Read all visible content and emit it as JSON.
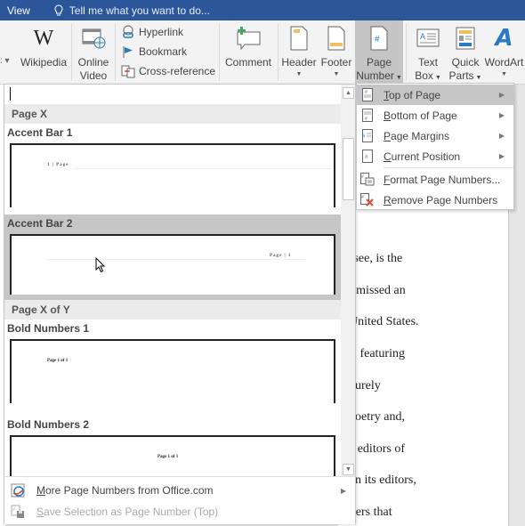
{
  "topbar": {
    "view_tab": "View",
    "tell_me_placeholder": "Tell me what you want to do...",
    "tell_me_icon": "lightbulb-icon"
  },
  "ribbon": {
    "buttons": [
      {
        "label": "Wikipedia",
        "icon": "wikipedia-icon"
      },
      {
        "label1": "Online",
        "label2": "Video",
        "icon": "online-video-icon"
      },
      {
        "label": "Comment",
        "icon": "comment-icon"
      },
      {
        "label": "Header",
        "icon": "header-icon"
      },
      {
        "label": "Footer",
        "icon": "footer-icon"
      },
      {
        "label1": "Page",
        "label2": "Number",
        "icon": "page-number-icon",
        "active": true
      },
      {
        "label1": "Text",
        "label2": "Box",
        "icon": "text-box-icon"
      },
      {
        "label1": "Quick",
        "label2": "Parts",
        "icon": "quick-parts-icon"
      },
      {
        "label": "WordArt",
        "icon": "wordart-icon"
      }
    ],
    "links": [
      {
        "label": "Hyperlink",
        "icon": "hyperlink-icon"
      },
      {
        "label": "Bookmark",
        "icon": "bookmark-icon"
      },
      {
        "label": "Cross-reference",
        "icon": "cross-reference-icon"
      }
    ]
  },
  "gallery": {
    "categories": [
      {
        "name": "Page X",
        "items": [
          {
            "title": "Accent Bar 1",
            "preview": "1 | Page"
          },
          {
            "title": "Accent Bar 2",
            "preview": "Page | 1",
            "hover": true
          }
        ]
      },
      {
        "name": "Page X of Y",
        "items": [
          {
            "title": "Bold Numbers 1",
            "preview": "Page 1 of 1"
          },
          {
            "title": "Bold Numbers 2",
            "preview": "Page 1 of 1"
          }
        ]
      }
    ],
    "footer": [
      {
        "label": "More Page Numbers from Office.com",
        "mnemonic": "M",
        "icon": "office-online-icon",
        "submenu": true,
        "disabled": false
      },
      {
        "label": "Save Selection as Page Number (Top)",
        "mnemonic": "S",
        "icon": "save-selection-icon",
        "submenu": false,
        "disabled": true
      }
    ]
  },
  "menu": {
    "items": [
      {
        "label": "Top of Page",
        "mnemonic": "T",
        "icon": "top-of-page-icon",
        "submenu": true,
        "hover": true
      },
      {
        "label": "Bottom of Page",
        "mnemonic": "B",
        "icon": "bottom-of-page-icon",
        "submenu": true
      },
      {
        "label": "Page Margins",
        "mnemonic": "P",
        "icon": "page-margins-icon",
        "submenu": true
      },
      {
        "label": "Current Position",
        "mnemonic": "C",
        "icon": "current-position-icon",
        "submenu": true
      },
      {
        "label": "Format Page Numbers...",
        "mnemonic": "F",
        "icon": "format-page-numbers-icon",
        "submenu": false
      },
      {
        "label": "Remove Page Numbers",
        "mnemonic": "R",
        "icon": "remove-page-numbers-icon",
        "submenu": false
      }
    ]
  },
  "document": {
    "lines": [
      "ssee, is the",
      "r missed an",
      "United States.",
      "s, featuring",
      "purely",
      "poetry and,",
      "e editors of",
      "on its editors,",
      "iters that"
    ]
  }
}
